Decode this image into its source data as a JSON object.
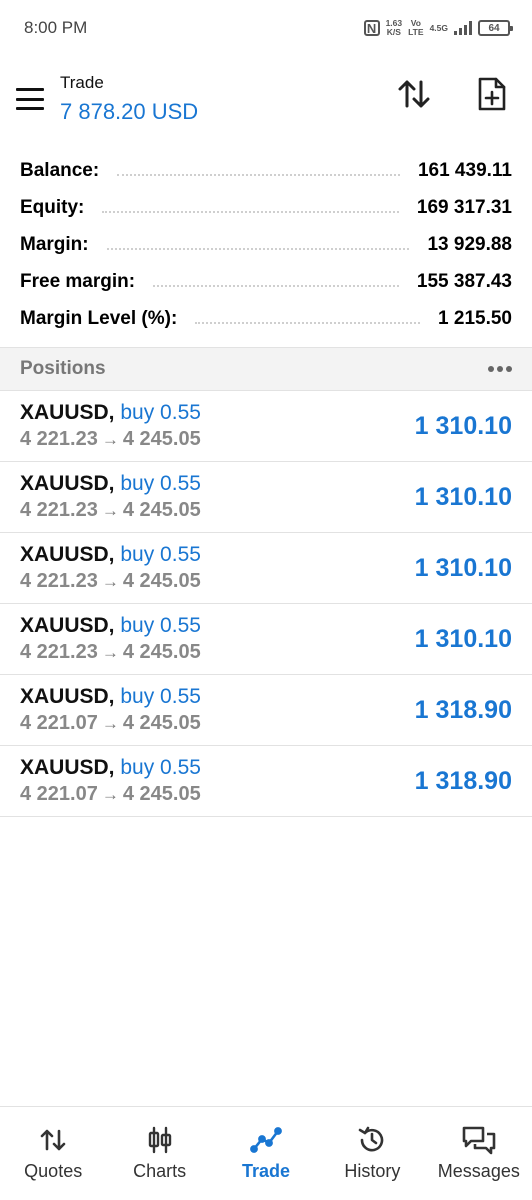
{
  "status_bar": {
    "time": "8:00 PM",
    "nfc": "N",
    "speed_value": "1.63",
    "speed_unit": "K/S",
    "volte_top": "Vo",
    "volte_bottom": "LTE",
    "network": "4.5G",
    "battery": "64"
  },
  "header": {
    "title": "Trade",
    "subtitle": "7 878.20 USD"
  },
  "summary": [
    {
      "label": "Balance:",
      "value": "161 439.11"
    },
    {
      "label": "Equity:",
      "value": "169 317.31"
    },
    {
      "label": "Margin:",
      "value": "13 929.88"
    },
    {
      "label": "Free margin:",
      "value": "155 387.43"
    },
    {
      "label": "Margin Level (%):",
      "value": "1 215.50"
    }
  ],
  "positions_section": {
    "title": "Positions"
  },
  "positions": [
    {
      "symbol": "XAUUSD,",
      "side": "buy 0.55",
      "open": "4 221.23",
      "arrow": "→",
      "current": "4 245.05",
      "profit": "1 310.10"
    },
    {
      "symbol": "XAUUSD,",
      "side": "buy 0.55",
      "open": "4 221.23",
      "arrow": "→",
      "current": "4 245.05",
      "profit": "1 310.10"
    },
    {
      "symbol": "XAUUSD,",
      "side": "buy 0.55",
      "open": "4 221.23",
      "arrow": "→",
      "current": "4 245.05",
      "profit": "1 310.10"
    },
    {
      "symbol": "XAUUSD,",
      "side": "buy 0.55",
      "open": "4 221.23",
      "arrow": "→",
      "current": "4 245.05",
      "profit": "1 310.10"
    },
    {
      "symbol": "XAUUSD,",
      "side": "buy 0.55",
      "open": "4 221.07",
      "arrow": "→",
      "current": "4 245.05",
      "profit": "1 318.90"
    },
    {
      "symbol": "XAUUSD,",
      "side": "buy 0.55",
      "open": "4 221.07",
      "arrow": "→",
      "current": "4 245.05",
      "profit": "1 318.90"
    }
  ],
  "bottom_nav": [
    {
      "label": "Quotes",
      "icon": "quotes-arrows-icon",
      "active": false
    },
    {
      "label": "Charts",
      "icon": "candlestick-icon",
      "active": false
    },
    {
      "label": "Trade",
      "icon": "trade-line-icon",
      "active": true
    },
    {
      "label": "History",
      "icon": "history-clock-icon",
      "active": false
    },
    {
      "label": "Messages",
      "icon": "messages-bubbles-icon",
      "active": false
    }
  ],
  "colors": {
    "accent": "#1976d2",
    "text": "#111111",
    "muted": "#888888",
    "section_bg": "#f3f3f3",
    "divider": "#e2e2e2"
  }
}
